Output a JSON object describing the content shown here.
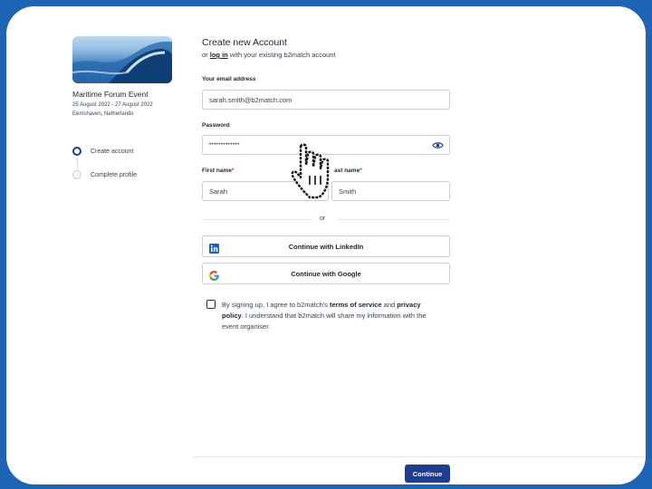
{
  "event": {
    "name": "Maritime Forum Event",
    "dates": "25 August 2022 - 27 August 2022",
    "location": "Eemshaven, Netherlands"
  },
  "steps": [
    {
      "label": "Create account",
      "active": true
    },
    {
      "label": "Complete profile",
      "active": false
    }
  ],
  "form": {
    "title": "Create new Account",
    "subtitle_prefix": "or",
    "login_link": "log in",
    "subtitle_suffix": "with your existing b2match account",
    "email_label": "Your email address",
    "email_value": "sarah.smith@b2match.com",
    "password_label": "Password",
    "password_value": "•••••••••••••",
    "first_name_label": "First name",
    "first_name_value": "Sarah",
    "last_name_label": "ast name",
    "last_name_value": "Smith",
    "required_mark": "*",
    "or_text": "or",
    "linkedin_label": "Continue with LinkedIn",
    "google_label": "Continue with Google",
    "terms": {
      "t1": "By signing up, I agree to b2match's",
      "tos": "terms of service",
      "t2": "and",
      "privacy": "privacy policy",
      "t3": ". I understand that b2match will share my information with the event organiser."
    },
    "continue_label": "Continue"
  },
  "colors": {
    "frame_blue": "#1e64b4",
    "primary_navy": "#1e3d8f",
    "required_red": "#d11d2a",
    "linkedin_blue": "#0a66c2"
  },
  "icons": [
    "eye-icon",
    "linkedin-icon",
    "google-icon",
    "hand-pointer-cursor-icon"
  ]
}
